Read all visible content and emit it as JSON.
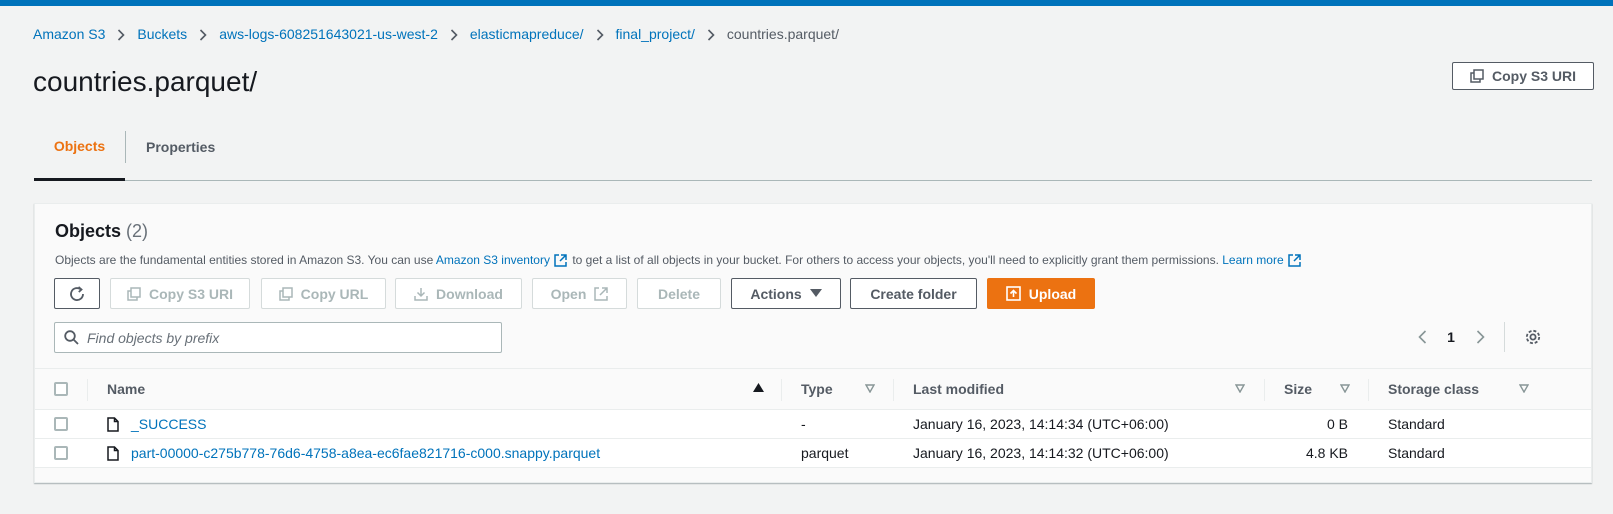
{
  "breadcrumb": {
    "items": [
      "Amazon S3",
      "Buckets",
      "aws-logs-608251643021-us-west-2",
      "elasticmapreduce/",
      "final_project/"
    ],
    "current": "countries.parquet/"
  },
  "page": {
    "title": "countries.parquet/",
    "copy_uri_label": "Copy S3 URI"
  },
  "tabs": [
    {
      "label": "Objects",
      "active": true
    },
    {
      "label": "Properties",
      "active": false
    }
  ],
  "objects_panel": {
    "title": "Objects",
    "count": "(2)",
    "desc_part1": "Objects are the fundamental entities stored in Amazon S3. You can use ",
    "desc_link1": "Amazon S3 inventory",
    "desc_part2": " to get a list of all objects in your bucket. For others to access your objects, you'll need to explicitly grant them permissions. ",
    "desc_link2": "Learn more"
  },
  "toolbar": {
    "copy_s3_uri": "Copy S3 URI",
    "copy_url": "Copy URL",
    "download": "Download",
    "open": "Open",
    "delete": "Delete",
    "actions": "Actions",
    "create_folder": "Create folder",
    "upload": "Upload"
  },
  "search": {
    "placeholder": "Find objects by prefix",
    "value": ""
  },
  "pagination": {
    "current_page": "1"
  },
  "table": {
    "columns": {
      "name": "Name",
      "type": "Type",
      "last_modified": "Last modified",
      "size": "Size",
      "storage_class": "Storage class"
    },
    "rows": [
      {
        "name": "_SUCCESS",
        "type": "-",
        "last_modified": "January 16, 2023, 14:14:34 (UTC+06:00)",
        "size": "0 B",
        "storage_class": "Standard"
      },
      {
        "name": "part-00000-c275b778-76d6-4758-a8ea-ec6fae821716-c000.snappy.parquet",
        "type": "parquet",
        "last_modified": "January 16, 2023, 14:14:32 (UTC+06:00)",
        "size": "4.8 KB",
        "storage_class": "Standard"
      }
    ]
  },
  "colors": {
    "accent": "#ec7211",
    "link": "#0073bb",
    "top_bar": "#0073bb"
  }
}
